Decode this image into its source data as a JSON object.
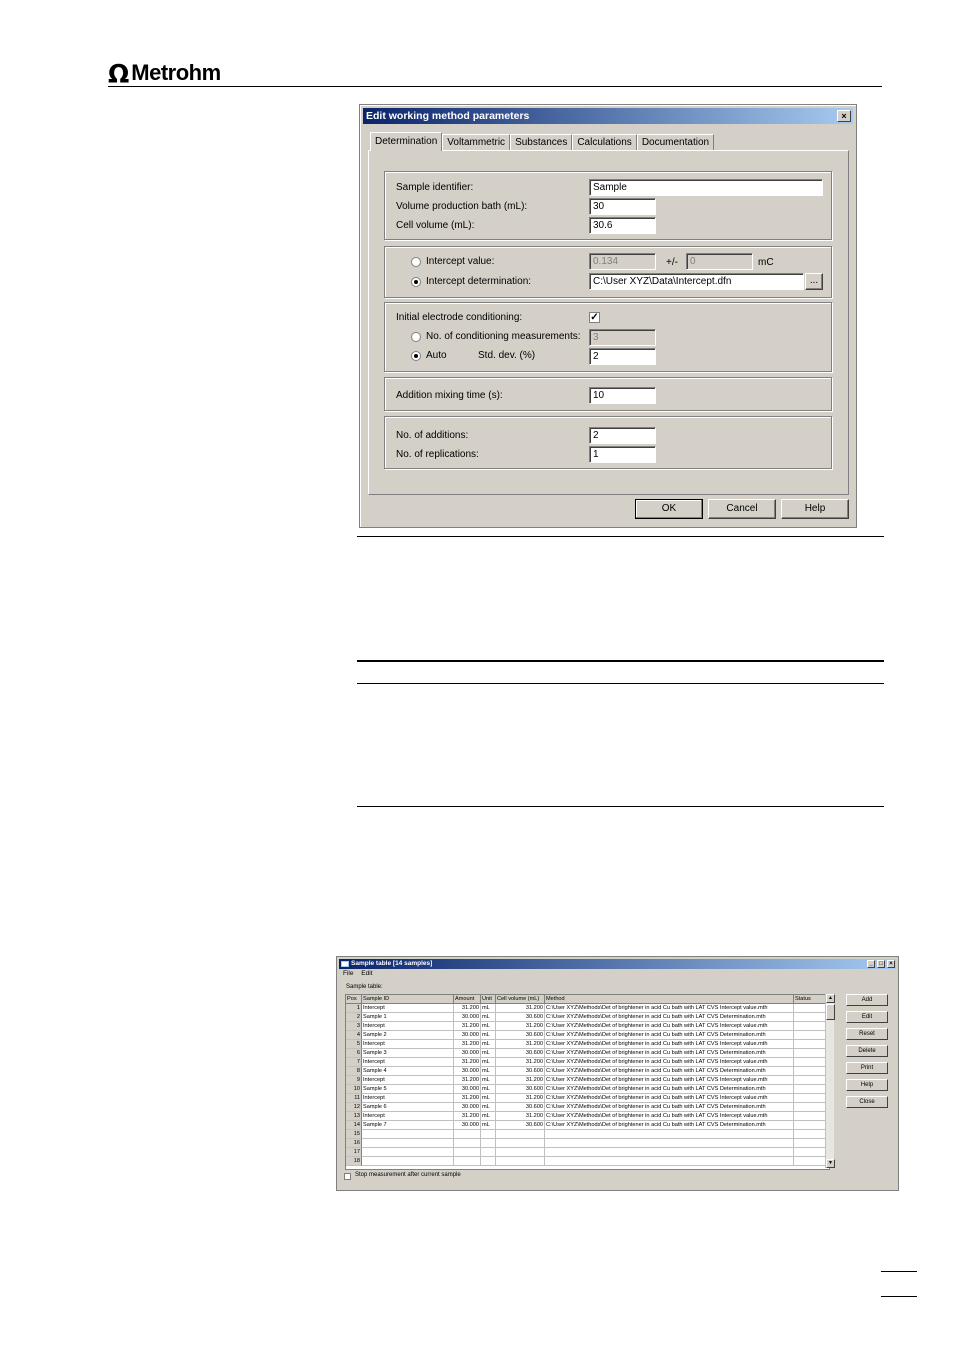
{
  "header": {
    "logo_symbol": "Ω",
    "logo_text": "Metrohm"
  },
  "dialog": {
    "title": "Edit working method parameters",
    "close_label": "×",
    "tabs": [
      "Determination",
      "Voltammetric",
      "Substances",
      "Calculations",
      "Documentation"
    ],
    "fields": {
      "sample_identifier": {
        "label": "Sample identifier:",
        "value": "Sample"
      },
      "volume_production_bath": {
        "label": "Volume production bath (mL):",
        "value": "30"
      },
      "cell_volume": {
        "label": "Cell volume (mL):",
        "value": "30.6"
      },
      "intercept_value": {
        "label": "Intercept value:",
        "value": "0.134",
        "pm": "+/-",
        "pm_value": "0",
        "unit": "mC"
      },
      "intercept_determination": {
        "label": "Intercept determination:",
        "value": "C:\\User XYZ\\Data\\Intercept.dfn",
        "browse": "..."
      },
      "initial_conditioning": {
        "label": "Initial electrode conditioning:",
        "check": "✓"
      },
      "no_conditioning": {
        "label": "No. of conditioning measurements:",
        "value": "3"
      },
      "auto": {
        "label": "Auto",
        "std_label": "Std. dev. (%)",
        "value": "2"
      },
      "addition_mixing_time": {
        "label": "Addition mixing time (s):",
        "value": "10"
      },
      "no_additions": {
        "label": "No. of additions:",
        "value": "2"
      },
      "no_replications": {
        "label": "No. of replications:",
        "value": "1"
      }
    },
    "buttons": {
      "ok": "OK",
      "cancel": "Cancel",
      "help": "Help"
    }
  },
  "sample_table": {
    "title": "Sample table [14 samples]",
    "window_buttons": [
      "_",
      "□",
      "×"
    ],
    "menu": [
      "File",
      "Edit"
    ],
    "label": "Sample table:",
    "columns": [
      "Pos",
      "Sample ID",
      "Amount",
      "Unit",
      "Cell volume (mL)",
      "Method",
      "Status"
    ],
    "rows": [
      [
        "1",
        "Intercept",
        "31.200",
        "mL",
        "31.200",
        "C:\\User XYZ\\Methods\\Det of brightener in acid Cu bath with LAT CVS Intercept value.mth",
        ""
      ],
      [
        "2",
        "Sample 1",
        "30.000",
        "mL",
        "30.600",
        "C:\\User XYZ\\Methods\\Det of brightener in acid Cu bath with LAT CVS Determination.mth",
        ""
      ],
      [
        "3",
        "Intercept",
        "31.200",
        "mL",
        "31.200",
        "C:\\User XYZ\\Methods\\Det of brightener in acid Cu bath with LAT CVS Intercept value.mth",
        ""
      ],
      [
        "4",
        "Sample 2",
        "30.000",
        "mL",
        "30.600",
        "C:\\User XYZ\\Methods\\Det of brightener in acid Cu bath with LAT CVS Determination.mth",
        ""
      ],
      [
        "5",
        "Intercept",
        "31.200",
        "mL",
        "31.200",
        "C:\\User XYZ\\Methods\\Det of brightener in acid Cu bath with LAT CVS Intercept value.mth",
        ""
      ],
      [
        "6",
        "Sample 3",
        "30.000",
        "mL",
        "30.600",
        "C:\\User XYZ\\Methods\\Det of brightener in acid Cu bath with LAT CVS Determination.mth",
        ""
      ],
      [
        "7",
        "Intercept",
        "31.200",
        "mL",
        "31.200",
        "C:\\User XYZ\\Methods\\Det of brightener in acid Cu bath with LAT CVS Intercept value.mth",
        ""
      ],
      [
        "8",
        "Sample 4",
        "30.000",
        "mL",
        "30.600",
        "C:\\User XYZ\\Methods\\Det of brightener in acid Cu bath with LAT CVS Determination.mth",
        ""
      ],
      [
        "9",
        "Intercept",
        "31.200",
        "mL",
        "31.200",
        "C:\\User XYZ\\Methods\\Det of brightener in acid Cu bath with LAT CVS Intercept value.mth",
        ""
      ],
      [
        "10",
        "Sample 5",
        "30.000",
        "mL",
        "30.600",
        "C:\\User XYZ\\Methods\\Det of brightener in acid Cu bath with LAT CVS Determination.mth",
        ""
      ],
      [
        "11",
        "Intercept",
        "31.200",
        "mL",
        "31.200",
        "C:\\User XYZ\\Methods\\Det of brightener in acid Cu bath with LAT CVS Intercept value.mth",
        ""
      ],
      [
        "12",
        "Sample 6",
        "30.000",
        "mL",
        "30.600",
        "C:\\User XYZ\\Methods\\Det of brightener in acid Cu bath with LAT CVS Determination.mth",
        ""
      ],
      [
        "13",
        "Intercept",
        "31.200",
        "mL",
        "31.200",
        "C:\\User XYZ\\Methods\\Det of brightener in acid Cu bath with LAT CVS Intercept value.mth",
        ""
      ],
      [
        "14",
        "Sample 7",
        "30.000",
        "mL",
        "30.600",
        "C:\\User XYZ\\Methods\\Det of brightener in acid Cu bath with LAT CVS Determination.mth",
        ""
      ],
      [
        "15",
        "",
        "",
        "",
        "",
        "",
        ""
      ],
      [
        "16",
        "",
        "",
        "",
        "",
        "",
        ""
      ],
      [
        "17",
        "",
        "",
        "",
        "",
        "",
        ""
      ],
      [
        "18",
        "",
        "",
        "",
        "",
        "",
        ""
      ]
    ],
    "buttons": [
      "Add",
      "Edit",
      "Reset",
      "Delete",
      "Print",
      "Help",
      "Close"
    ],
    "stop_label": "Stop measurement after current sample"
  }
}
